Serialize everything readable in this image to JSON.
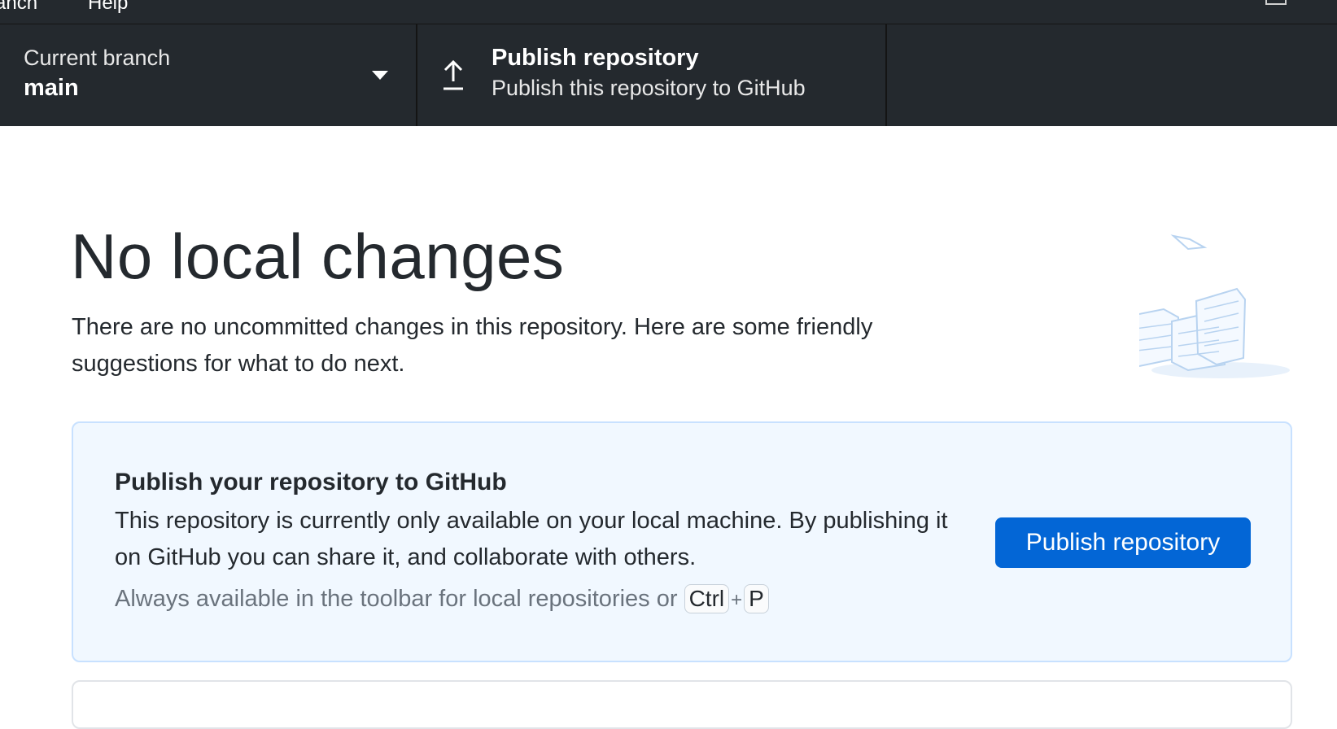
{
  "menu": {
    "items": [
      {
        "label": "anch"
      },
      {
        "label": "Help"
      }
    ]
  },
  "toolbar": {
    "branch": {
      "label": "Current branch",
      "value": "main"
    },
    "publish": {
      "title": "Publish repository",
      "description": "Publish this repository to GitHub"
    }
  },
  "main": {
    "title": "No local changes",
    "description": "There are no uncommitted changes in this repository. Here are some friendly suggestions for what to do next."
  },
  "suggestion": {
    "title": "Publish your repository to GitHub",
    "description": "This repository is currently only available on your local machine. By publishing it on GitHub you can share it, and collaborate with others.",
    "hint_prefix": "Always available in the toolbar for local repositories or",
    "shortcut_keys": [
      "Ctrl",
      "P"
    ],
    "shortcut_joiner": "+",
    "button_label": "Publish repository"
  },
  "colors": {
    "toolbar_bg": "#24292e",
    "accent": "#0366d6",
    "card_bg": "#f1f8ff",
    "card_border": "#c8e1ff"
  },
  "icons": {
    "branch_dropdown": "chevron-down-icon",
    "publish": "arrow-up-icon",
    "illustration": "empty-state-illustration"
  }
}
